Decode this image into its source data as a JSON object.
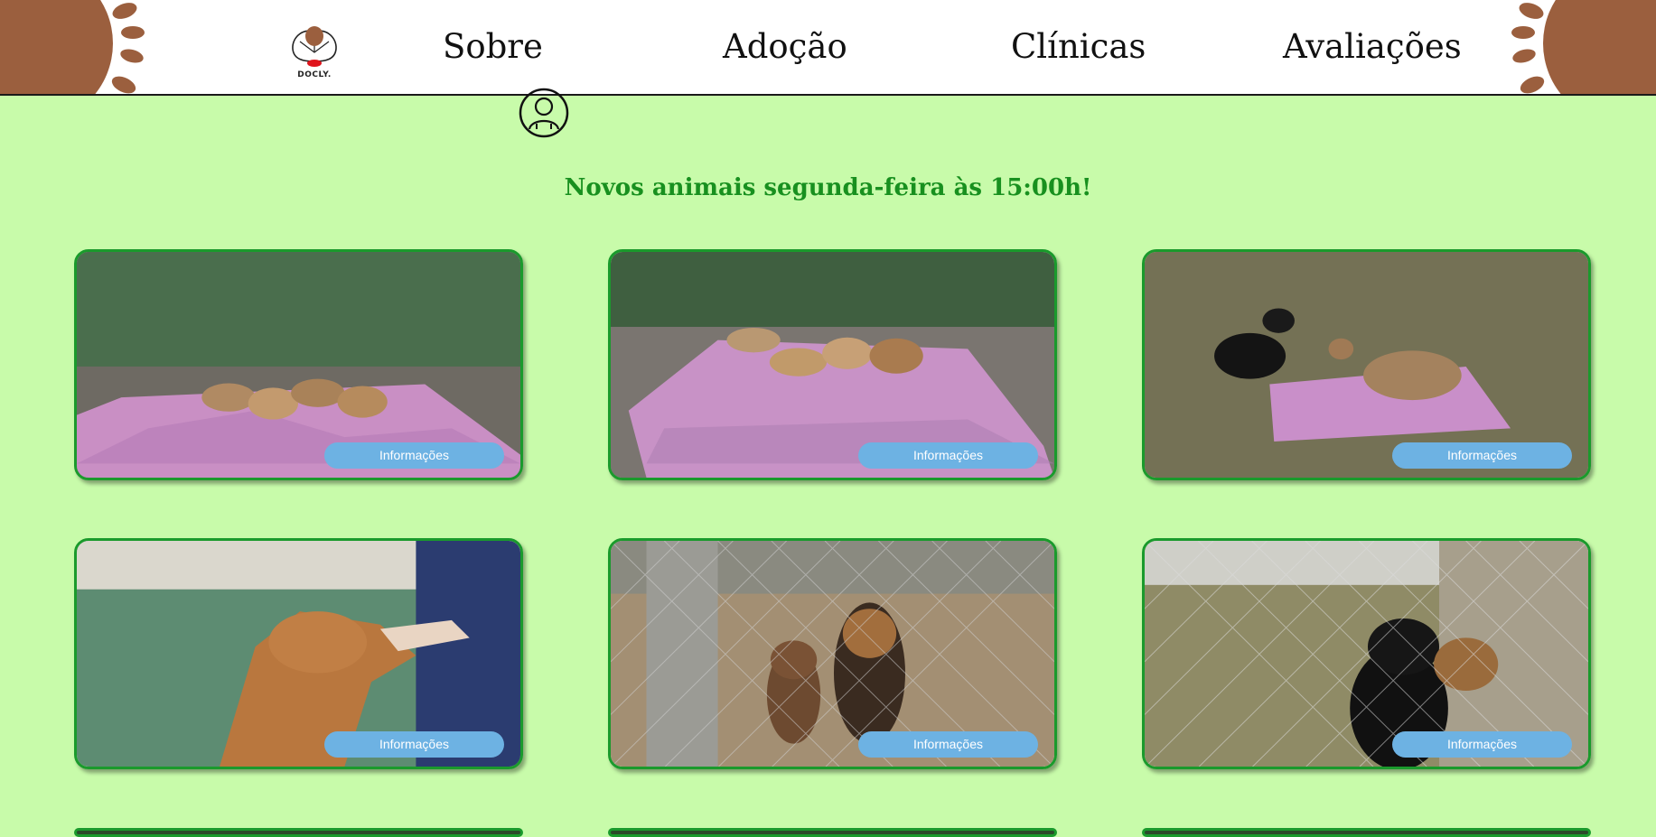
{
  "header": {
    "logo_text": "DOCLY.",
    "nav": [
      {
        "label": "Sobre"
      },
      {
        "label": "Adoção"
      },
      {
        "label": "Clínicas"
      },
      {
        "label": "Avaliações"
      }
    ],
    "icons": [
      "paw-icon",
      "logo-icon",
      "user-icon"
    ]
  },
  "announcement": "Novos animais segunda-feira às 15:00h!",
  "cards": [
    {
      "button_label": "Informações",
      "photo": "puppies on pink blanket"
    },
    {
      "button_label": "Informações",
      "photo": "puppies on pink blanket"
    },
    {
      "button_label": "Informações",
      "photo": "black puppy and tan puppy on grass"
    },
    {
      "button_label": "Informações",
      "photo": "tan dog greeting person"
    },
    {
      "button_label": "Informações",
      "photo": "two dogs behind fence"
    },
    {
      "button_label": "Informações",
      "photo": "black and tan dogs behind fence"
    }
  ],
  "colors": {
    "background": "#c8fbaa",
    "accent_green": "#18901f",
    "card_border": "#1a9a2c",
    "button": "#6db2e3",
    "paw": "#9b5f3e"
  }
}
